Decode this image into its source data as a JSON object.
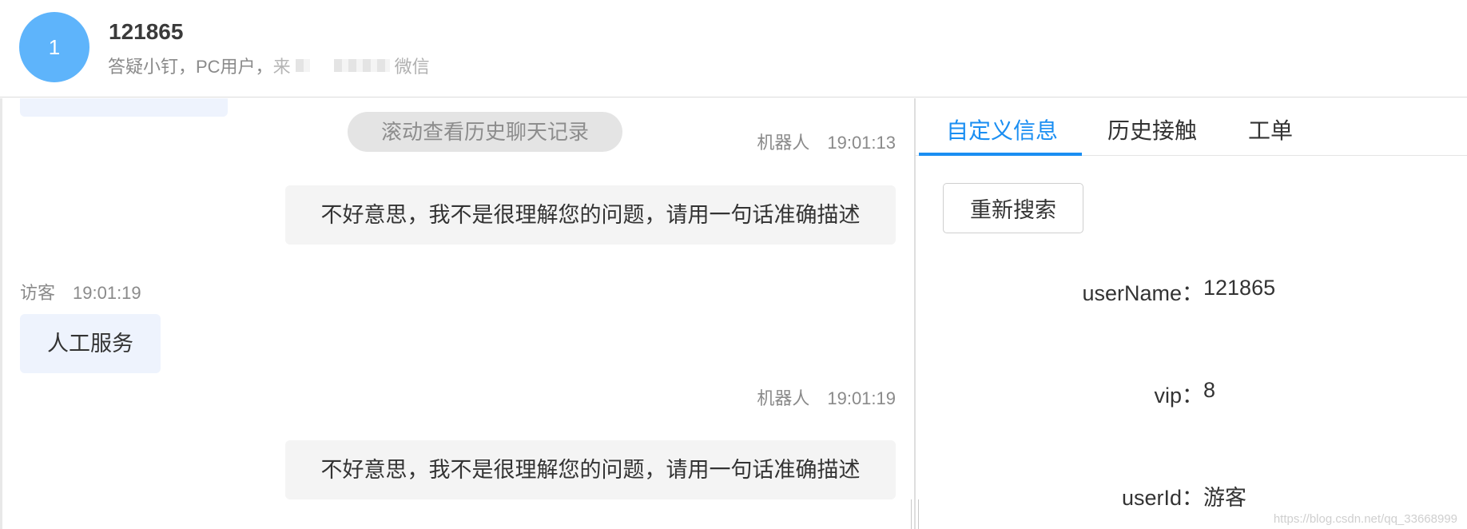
{
  "header": {
    "avatar_text": "1",
    "user_name": "121865",
    "subtitle": "答疑小钉，PC用户，",
    "subtitle_redacted_start": "来",
    "subtitle_redacted_end": "微信"
  },
  "chat": {
    "history_hint": "滚动查看历史聊天记录",
    "messages": [
      {
        "sender": "机器人",
        "time": "19:01:13",
        "text": "不好意思，我不是很理解您的问题，请用一句话准确描述"
      },
      {
        "sender": "访客",
        "time": "19:01:19",
        "text": "人工服务"
      },
      {
        "sender": "机器人",
        "time": "19:01:19",
        "text": "不好意思，我不是很理解您的问题，请用一句话准确描述"
      }
    ]
  },
  "panel": {
    "tabs": [
      {
        "label": "自定义信息",
        "active": true
      },
      {
        "label": "历史接触",
        "active": false
      },
      {
        "label": "工单",
        "active": false
      }
    ],
    "search_button": "重新搜索",
    "fields": [
      {
        "key": "userName：",
        "value": "121865"
      },
      {
        "key": "vip：",
        "value": "8"
      },
      {
        "key": "userId：",
        "value": "游客"
      }
    ]
  },
  "watermark": "https://blog.csdn.net/qq_33668999",
  "colors": {
    "accent": "#1a8ef2",
    "avatar_bg": "#5eb4fb",
    "visitor_bubble": "#eef3fd",
    "robot_bubble": "#f4f4f4"
  }
}
